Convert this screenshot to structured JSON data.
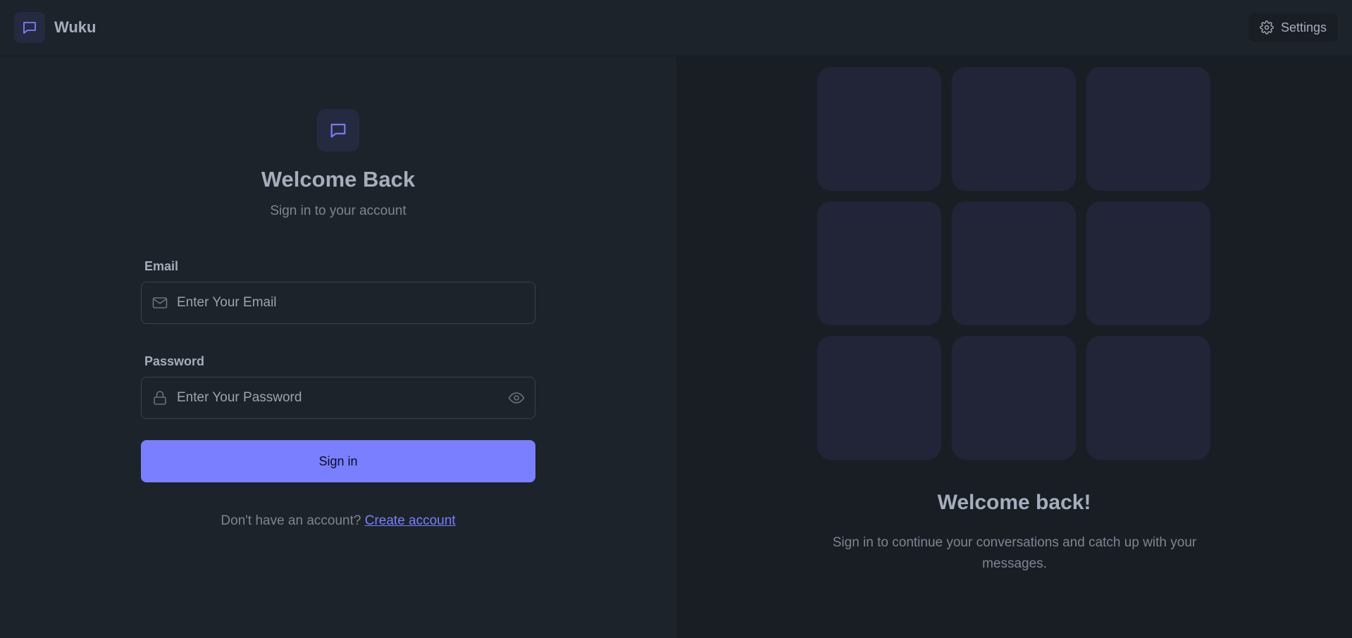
{
  "app": {
    "name": "Wuku",
    "logo_icon": "chat-bubble-icon",
    "accent": "#7a7fff"
  },
  "header": {
    "settings_label": "Settings",
    "settings_icon": "gear-icon"
  },
  "login": {
    "title": "Welcome Back",
    "subtitle": "Sign in to your account",
    "email": {
      "label": "Email",
      "placeholder": "Enter Your Email",
      "value": "",
      "icon": "mail-icon"
    },
    "password": {
      "label": "Password",
      "placeholder": "Enter Your Password",
      "value": "",
      "icon": "lock-icon",
      "toggle_icon": "eye-icon"
    },
    "submit_label": "Sign in",
    "signup_prompt": "Don't have an account?",
    "signup_link": "Create account"
  },
  "promo": {
    "title": "Welcome back!",
    "subtitle": "Sign in to continue your conversations and catch up with your messages.",
    "tile_count": 9
  }
}
